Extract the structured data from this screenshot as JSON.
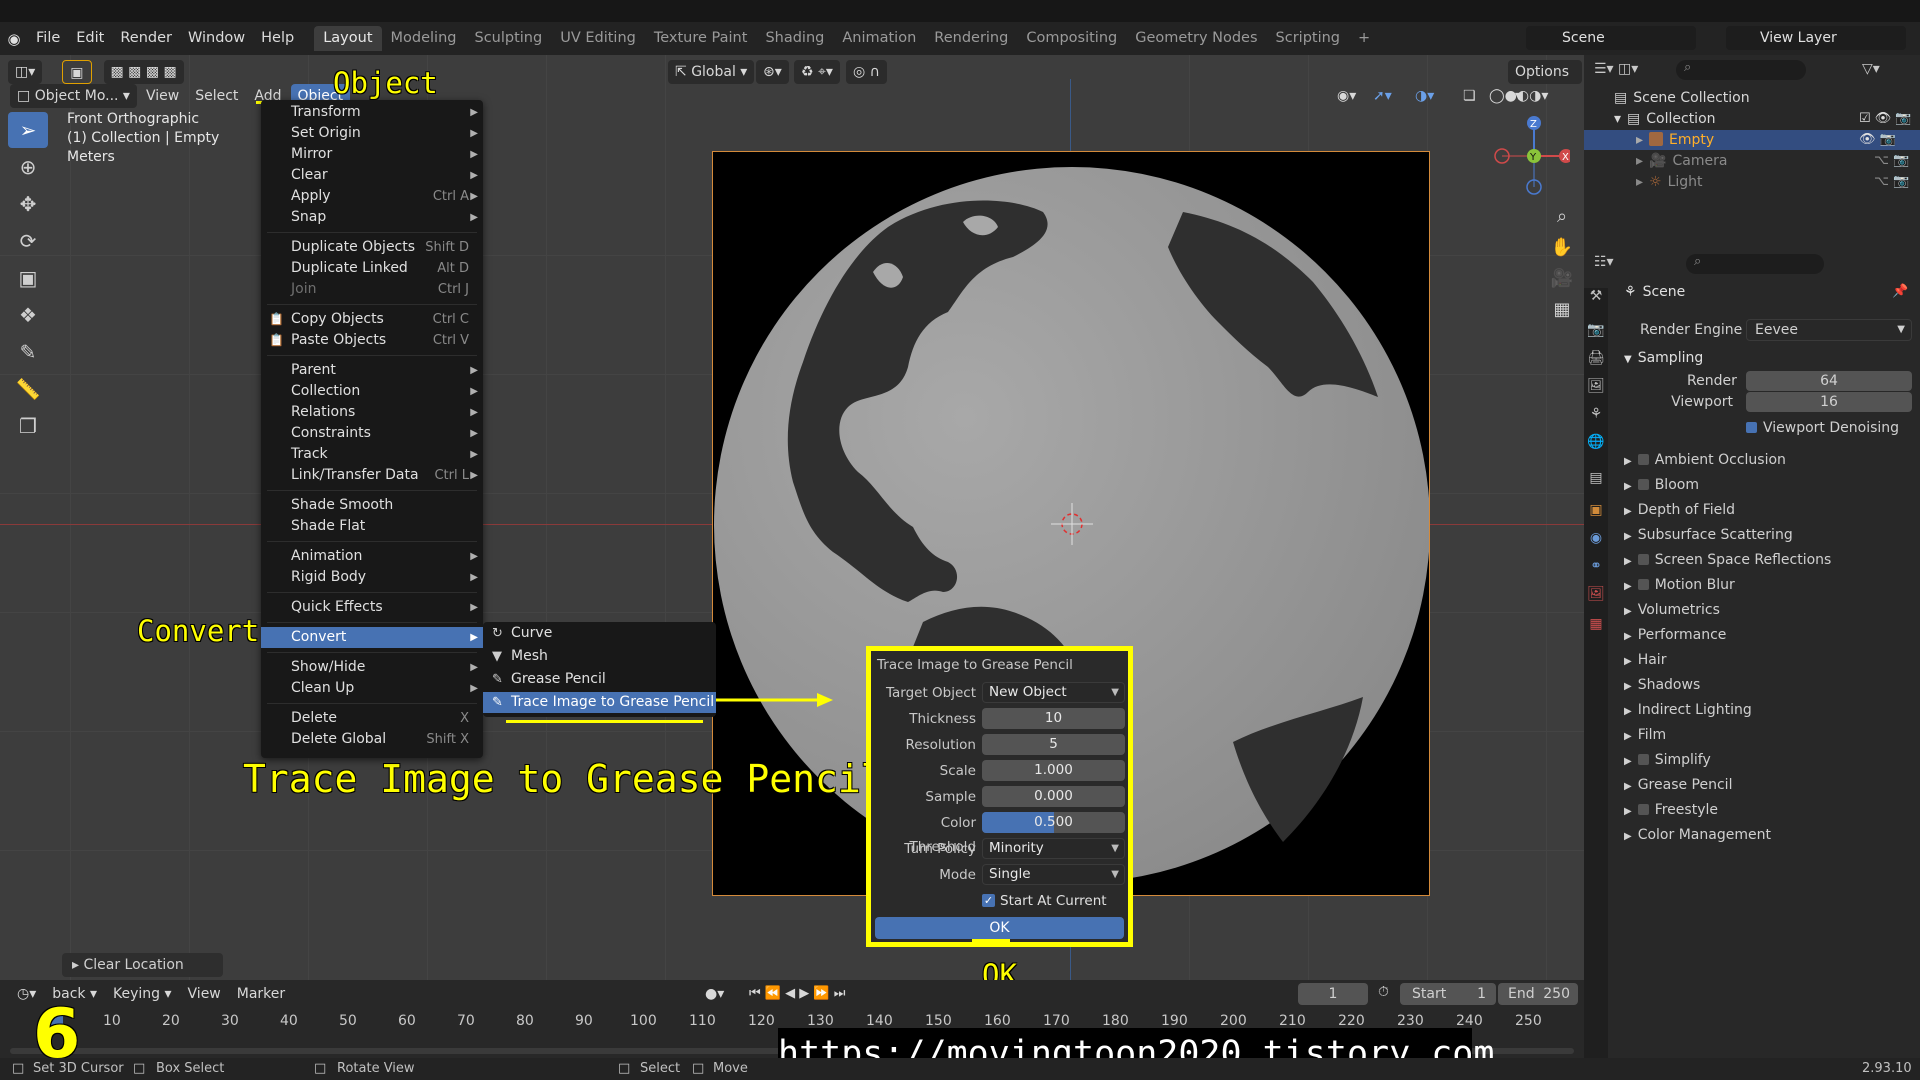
{
  "menubar": {
    "items": [
      "File",
      "Edit",
      "Render",
      "Window",
      "Help"
    ],
    "workspaces": [
      "Layout",
      "Modeling",
      "Sculpting",
      "UV Editing",
      "Texture Paint",
      "Shading",
      "Animation",
      "Rendering",
      "Compositing",
      "Geometry Nodes",
      "Scripting"
    ],
    "active_workspace": "Layout",
    "add_tab": "+",
    "scene": "Scene",
    "view_layer": "View Layer"
  },
  "viewport_header": {
    "mode": "Object Mo...",
    "menus": [
      "View",
      "Select",
      "Add",
      "Object"
    ],
    "transform_orientation": "Global",
    "options": "Options"
  },
  "viewport_info": {
    "line1": "Front Orthographic",
    "line2": "(1) Collection | Empty",
    "line3": "Meters"
  },
  "gizmo": {
    "z": "Z",
    "y": "Y",
    "x": "X"
  },
  "object_menu": {
    "items": [
      {
        "label": "Transform",
        "arrow": true
      },
      {
        "label": "Set Origin",
        "arrow": true
      },
      {
        "label": "Mirror",
        "arrow": true
      },
      {
        "label": "Clear",
        "arrow": true
      },
      {
        "label": "Apply",
        "shortcut": "Ctrl A",
        "arrow": true
      },
      {
        "label": "Snap",
        "arrow": true
      },
      {
        "label": "Duplicate Objects",
        "shortcut": "Shift D"
      },
      {
        "label": "Duplicate Linked",
        "shortcut": "Alt D"
      },
      {
        "label": "Join",
        "shortcut": "Ctrl J",
        "disabled": true
      },
      {
        "label": "Copy Objects",
        "shortcut": "Ctrl C"
      },
      {
        "label": "Paste Objects",
        "shortcut": "Ctrl V"
      },
      {
        "label": "Parent",
        "arrow": true
      },
      {
        "label": "Collection",
        "arrow": true
      },
      {
        "label": "Relations",
        "arrow": true
      },
      {
        "label": "Constraints",
        "arrow": true
      },
      {
        "label": "Track",
        "arrow": true
      },
      {
        "label": "Link/Transfer Data",
        "shortcut": "Ctrl L",
        "arrow": true
      },
      {
        "label": "Shade Smooth"
      },
      {
        "label": "Shade Flat"
      },
      {
        "label": "Animation",
        "arrow": true
      },
      {
        "label": "Rigid Body",
        "arrow": true
      },
      {
        "label": "Quick Effects",
        "arrow": true
      },
      {
        "label": "Convert",
        "arrow": true,
        "highlighted": true
      },
      {
        "label": "Show/Hide",
        "arrow": true
      },
      {
        "label": "Clean Up",
        "arrow": true
      },
      {
        "label": "Delete",
        "shortcut": "X"
      },
      {
        "label": "Delete Global",
        "shortcut": "Shift X"
      }
    ]
  },
  "convert_submenu": {
    "items": [
      {
        "label": "Curve",
        "icon": "curve-icon"
      },
      {
        "label": "Mesh",
        "icon": "mesh-icon"
      },
      {
        "label": "Grease Pencil",
        "icon": "grease-pencil-icon"
      },
      {
        "label": "Trace Image to Grease Pencil",
        "icon": "grease-pencil-icon",
        "highlighted": true
      }
    ]
  },
  "trace_dialog": {
    "title": "Trace Image to Grease Pencil",
    "target_object_label": "Target Object",
    "target_object": "New Object",
    "thickness_label": "Thickness",
    "thickness": "10",
    "resolution_label": "Resolution",
    "resolution": "5",
    "scale_label": "Scale",
    "scale": "1.000",
    "sample_label": "Sample",
    "sample": "0.000",
    "color_threshold_label": "Color Threshold",
    "color_threshold": "0.500",
    "color_threshold_fill": 0.5,
    "turn_policy_label": "Turn Policy",
    "turn_policy": "Minority",
    "mode_label": "Mode",
    "mode": "Single",
    "start_at_current": "Start At Current Fr...",
    "start_at_current_checked": true,
    "ok": "OK"
  },
  "annotations": {
    "object": "Object",
    "convert": "Convert",
    "trace": "Trace Image to Grease Pencil",
    "ok": "OK",
    "step": "6",
    "url": "https://movingtoon2020.tistory.com"
  },
  "last_operator": "Clear Location",
  "outliner": {
    "scene_collection": "Scene Collection",
    "collection": "Collection",
    "objects": [
      {
        "name": "Empty",
        "selected": true
      },
      {
        "name": "Camera"
      },
      {
        "name": "Light"
      }
    ]
  },
  "properties": {
    "scene": "Scene",
    "render_engine_label": "Render Engine",
    "render_engine": "Eevee",
    "sampling": "Sampling",
    "render_label": "Render",
    "render_samples": "64",
    "viewport_label": "Viewport",
    "viewport_samples": "16",
    "viewport_denoising": "Viewport Denoising",
    "panels": [
      {
        "label": "Ambient Occlusion",
        "checkbox": true
      },
      {
        "label": "Bloom",
        "checkbox": true
      },
      {
        "label": "Depth of Field"
      },
      {
        "label": "Subsurface Scattering"
      },
      {
        "label": "Screen Space Reflections",
        "checkbox": true
      },
      {
        "label": "Motion Blur",
        "checkbox": true
      },
      {
        "label": "Volumetrics"
      },
      {
        "label": "Performance"
      },
      {
        "label": "Hair"
      },
      {
        "label": "Shadows"
      },
      {
        "label": "Indirect Lighting"
      },
      {
        "label": "Film"
      },
      {
        "label": "Simplify",
        "checkbox": true
      },
      {
        "label": "Grease Pencil"
      },
      {
        "label": "Freestyle",
        "checkbox": true
      },
      {
        "label": "Color Management"
      }
    ]
  },
  "timeline": {
    "playback": "back",
    "keying": "Keying",
    "view": "View",
    "marker": "Marker",
    "current_frame": "1",
    "start_label": "Start",
    "start": "1",
    "end_label": "End",
    "end": "250",
    "ticks": [
      "10",
      "20",
      "30",
      "40",
      "50",
      "60",
      "70",
      "80",
      "90",
      "100",
      "110",
      "120",
      "130",
      "140",
      "150",
      "160",
      "170",
      "180",
      "190",
      "200",
      "210",
      "220",
      "230",
      "240",
      "250"
    ]
  },
  "statusbar": {
    "set_cursor": "Set 3D Cursor",
    "box_select": "Box Select",
    "rotate_view": "Rotate View",
    "select": "Select",
    "move": "Move",
    "version": "2.93.10"
  }
}
